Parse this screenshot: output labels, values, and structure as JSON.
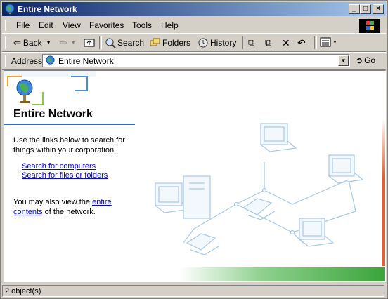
{
  "window": {
    "title": "Entire Network"
  },
  "menu": [
    "File",
    "Edit",
    "View",
    "Favorites",
    "Tools",
    "Help"
  ],
  "toolbar": {
    "back": "Back",
    "search": "Search",
    "folders": "Folders",
    "history": "History"
  },
  "address": {
    "label": "Address",
    "value": "Entire Network",
    "go": "Go"
  },
  "content": {
    "title": "Entire Network",
    "description": "Use the links below to search for things within your corporation.",
    "links": [
      "Search for computers",
      "Search for files or folders"
    ],
    "more_prefix": "You may also view the ",
    "more_link": "entire contents",
    "more_suffix": " of the network."
  },
  "status": {
    "text": "2 object(s)"
  },
  "colors": {
    "titlebar_start": "#0a246a",
    "titlebar_end": "#a6caf0",
    "link": "#0000ee",
    "accent": "#316ac5"
  }
}
